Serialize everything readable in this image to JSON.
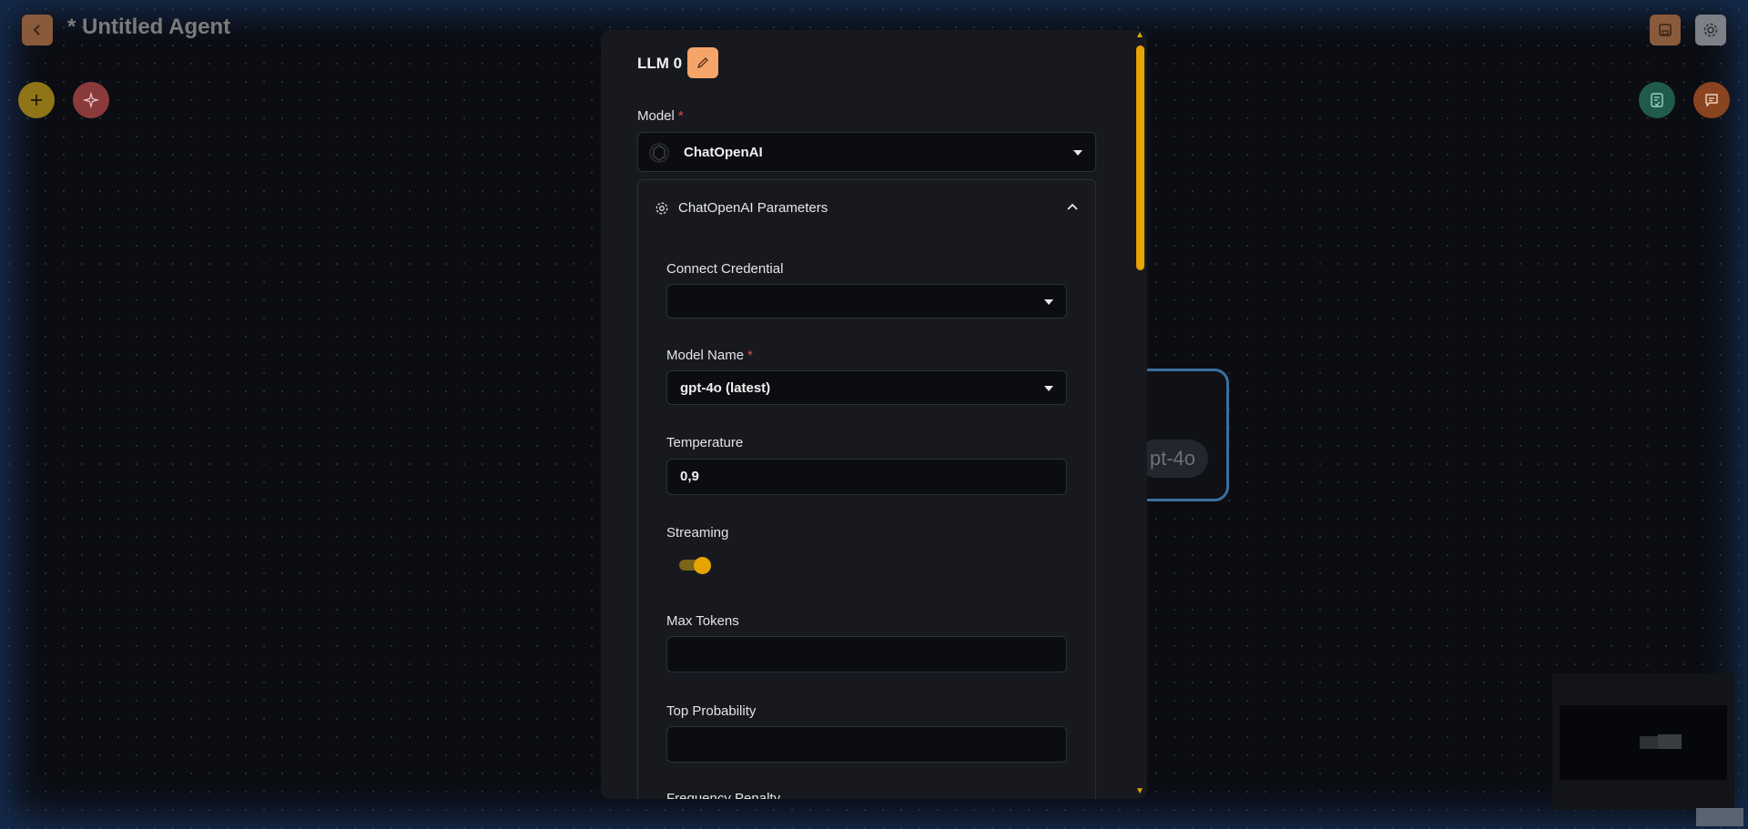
{
  "header": {
    "title": "* Untitled Agent",
    "back_icon": "chevron-left-icon",
    "save_icon": "save-icon",
    "settings_icon": "gear-icon"
  },
  "toolbar": {
    "add_icon": "plus-icon",
    "magic_icon": "sparkles-icon",
    "validate_icon": "checklist-icon",
    "chat_icon": "chat-icon"
  },
  "background_node": {
    "chip_text": "pt-4o"
  },
  "panel": {
    "title": "LLM 0",
    "edit_icon": "pencil-icon",
    "model": {
      "label": "Model",
      "required_mark": "*",
      "value": "ChatOpenAI",
      "icon": "openai-icon"
    },
    "params": {
      "title": "ChatOpenAI Parameters",
      "icon": "gear-icon",
      "collapse_icon": "chevron-up-icon",
      "fields": {
        "credential": {
          "label": "Connect Credential",
          "value": ""
        },
        "model_name": {
          "label": "Model Name",
          "required_mark": "*",
          "value": "gpt-4o (latest)"
        },
        "temperature": {
          "label": "Temperature",
          "value": "0,9"
        },
        "streaming": {
          "label": "Streaming",
          "enabled": true
        },
        "max_tokens": {
          "label": "Max Tokens",
          "value": ""
        },
        "top_probability": {
          "label": "Top Probability",
          "value": ""
        },
        "frequency_penalty": {
          "label": "Frequency Penalty"
        }
      }
    }
  },
  "colors": {
    "accent": "#e6a400",
    "edit_button": "#f5a46a",
    "required": "#e14c4c",
    "node_border": "#3a6fa0"
  }
}
